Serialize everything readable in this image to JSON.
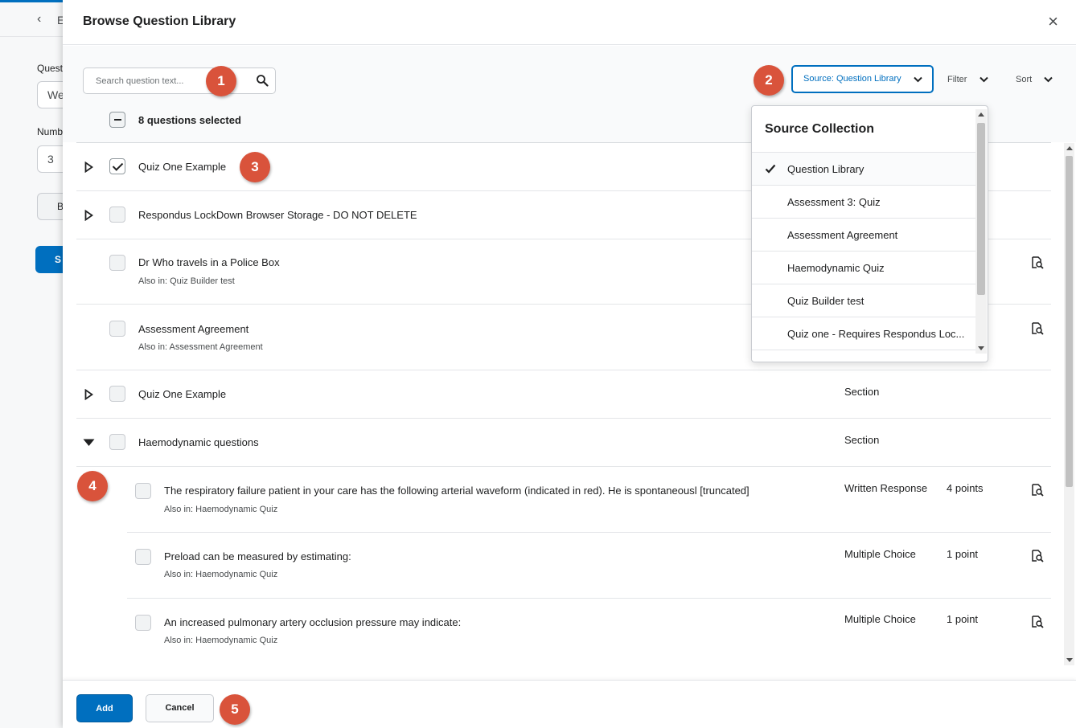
{
  "background": {
    "back_text": "E",
    "label1": "Quest",
    "input1": "We",
    "label2": "Numb",
    "input2": "3",
    "btn1": "B",
    "btn2": "S"
  },
  "dialog": {
    "title": "Browse Question Library",
    "close_label": "×"
  },
  "toolbar": {
    "search_placeholder": "Search question text...",
    "source_label": "Source: Question Library",
    "filter_label": "Filter",
    "sort_label": "Sort",
    "selected_count": "8 questions selected"
  },
  "rows": [
    {
      "title": "Quiz One Example",
      "sub": "",
      "type": "",
      "points": "",
      "checked": true,
      "expander": "collapsed",
      "preview": false
    },
    {
      "title": "Respondus LockDown Browser Storage - DO NOT DELETE",
      "sub": "",
      "type": "",
      "points": "",
      "checked": false,
      "expander": "collapsed",
      "preview": false
    },
    {
      "title": "Dr Who travels in a Police Box",
      "sub": "Also in: Quiz Builder test",
      "type": "",
      "points": "",
      "checked": false,
      "expander": "none",
      "preview": true
    },
    {
      "title": "Assessment Agreement",
      "sub": "Also in: Assessment Agreement",
      "type": "",
      "points": "",
      "checked": false,
      "expander": "none",
      "preview": true
    },
    {
      "title": "Quiz One Example",
      "sub": "",
      "type": "Section",
      "points": "",
      "checked": false,
      "expander": "collapsed",
      "preview": false
    },
    {
      "title": "Haemodynamic questions",
      "sub": "",
      "type": "Section",
      "points": "",
      "checked": false,
      "expander": "expanded",
      "preview": false
    },
    {
      "title": "The respiratory failure patient in your care has the following arterial waveform (indicated in red). He is spontaneousl [truncated]",
      "sub": "Also in: Haemodynamic Quiz",
      "type": "Written Response",
      "points": "4 points",
      "checked": false,
      "expander": "none",
      "preview": true
    },
    {
      "title": "Preload can be measured by estimating:",
      "sub": "Also in: Haemodynamic Quiz",
      "type": "Multiple Choice",
      "points": "1 point",
      "checked": false,
      "expander": "none",
      "preview": true
    },
    {
      "title": "An increased pulmonary artery occlusion pressure may indicate:",
      "sub": "Also in: Haemodynamic Quiz",
      "type": "Multiple Choice",
      "points": "1 point",
      "checked": false,
      "expander": "none",
      "preview": true
    }
  ],
  "dropdown": {
    "title": "Source Collection",
    "items": [
      {
        "label": "Question Library",
        "selected": true
      },
      {
        "label": "Assessment 3: Quiz",
        "selected": false
      },
      {
        "label": "Assessment Agreement",
        "selected": false
      },
      {
        "label": "Haemodynamic Quiz",
        "selected": false
      },
      {
        "label": "Quiz Builder test",
        "selected": false
      },
      {
        "label": "Quiz one - Requires Respondus Loc...",
        "selected": false
      }
    ]
  },
  "footer": {
    "add_label": "Add",
    "cancel_label": "Cancel"
  },
  "badges": [
    "1",
    "2",
    "3",
    "4",
    "5"
  ],
  "colors": {
    "primary": "#006fbf",
    "badge": "#d9533b",
    "text": "#202122"
  },
  "icons": {
    "search": "search-icon",
    "close": "close-icon",
    "chevron": "chevron-down-icon",
    "expander_collapsed": "caret-right-icon",
    "expander_expanded": "caret-down-icon",
    "preview": "preview-icon",
    "check": "checkmark-icon"
  }
}
